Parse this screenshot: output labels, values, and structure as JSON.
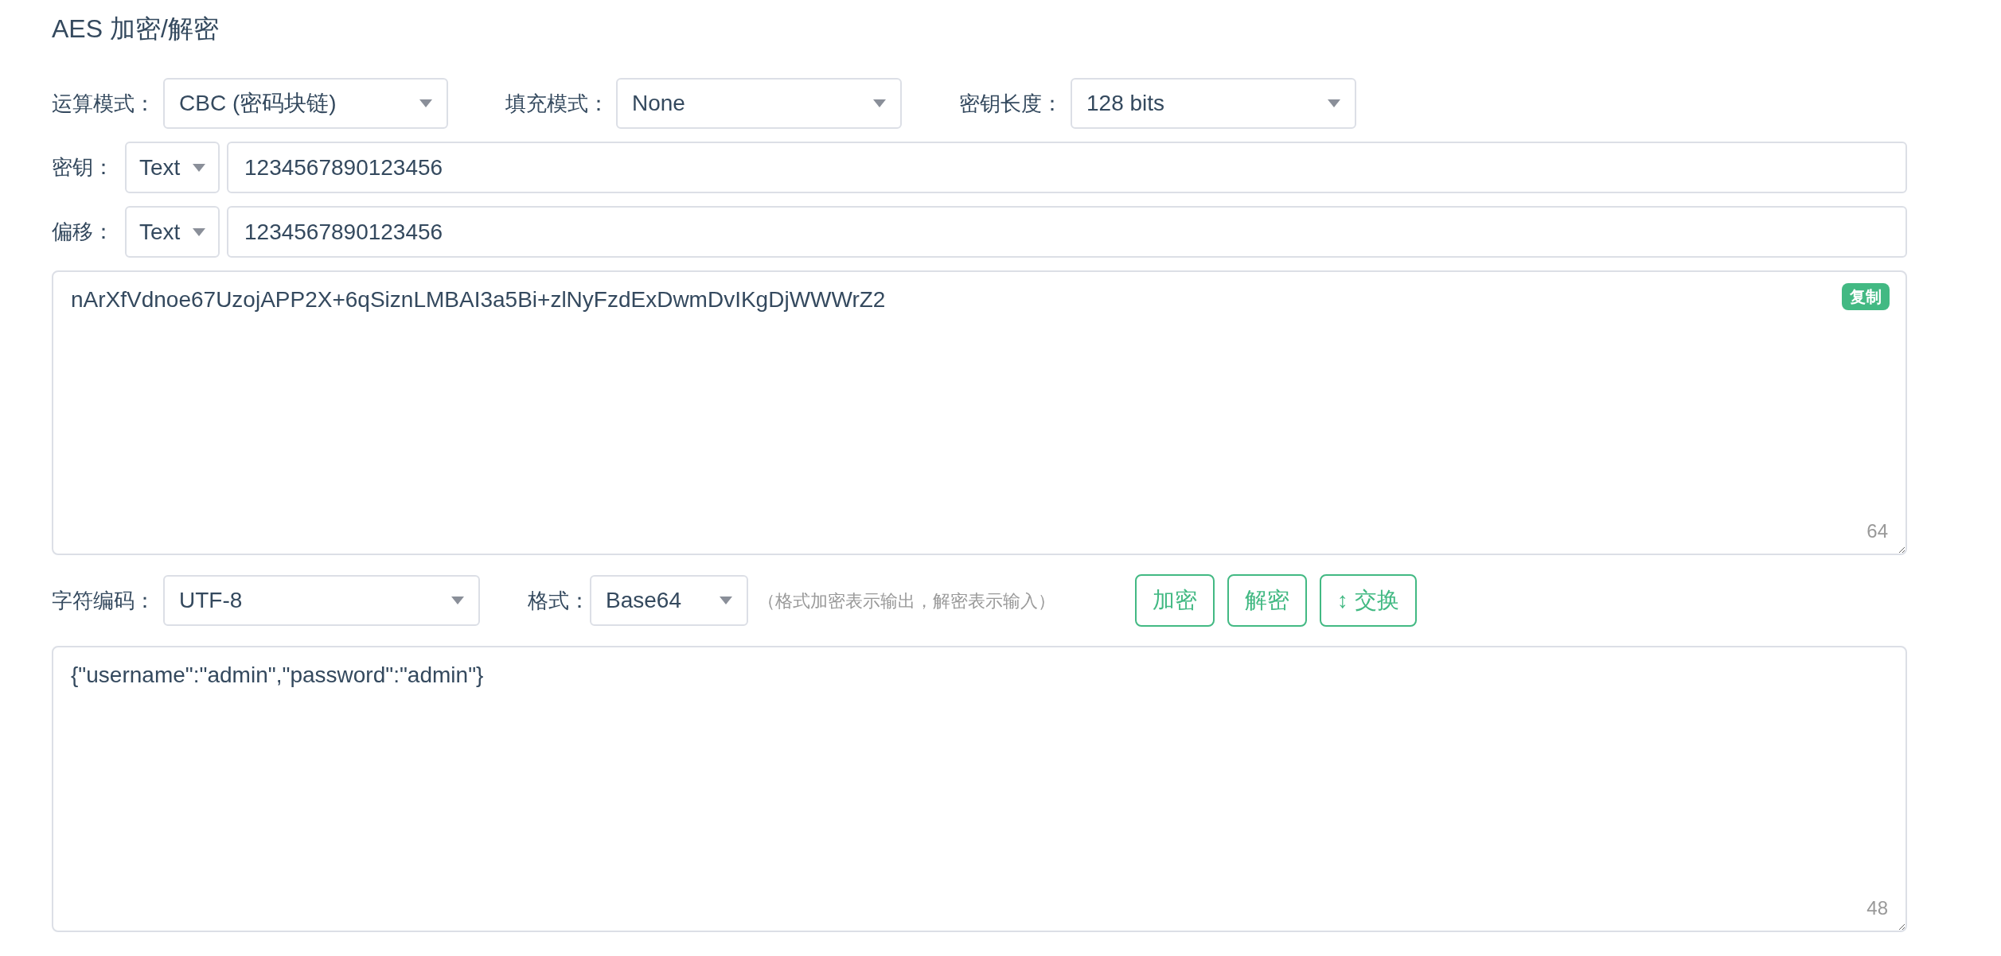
{
  "title": "AES 加密/解密",
  "settings": [
    {
      "label": "运算模式：",
      "value": "CBC (密码块链)"
    },
    {
      "label": "填充模式：",
      "value": "None"
    },
    {
      "label": "密钥长度：",
      "value": "128 bits"
    }
  ],
  "key": {
    "label": "密钥：",
    "type": "Text",
    "value": "1234567890123456"
  },
  "iv": {
    "label": "偏移：",
    "type": "Text",
    "value": "1234567890123456"
  },
  "output": {
    "value": "nArXfVdnoe67UzojAPP2X+6qSiznLMBAI3a5Bi+zlNyFzdExDwmDvIKgDjWWWrZ2",
    "copy_button": "复制",
    "count": "64"
  },
  "encoding": {
    "label": "字符编码：",
    "value": "UTF-8"
  },
  "format": {
    "label": "格式：",
    "value": "Base64",
    "hint": "（格式加密表示输出，解密表示输入）"
  },
  "buttons": [
    {
      "label": "加密"
    },
    {
      "label": "解密"
    },
    {
      "label": "↕ 交换"
    }
  ],
  "input": {
    "value": "{\"username\":\"admin\",\"password\":\"admin\"}",
    "count": "48"
  }
}
